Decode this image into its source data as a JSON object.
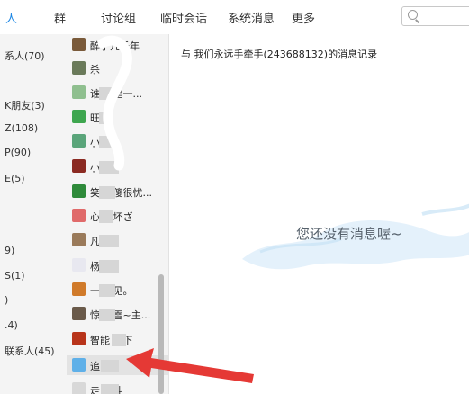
{
  "tabs": [
    "人",
    "群",
    "讨论组",
    "临时会话",
    "系统消息",
    "更多"
  ],
  "search": {
    "placeholder": ""
  },
  "groups": [
    "系人(70)",
    "K朋友(3)",
    "Z(108)",
    "P(90)",
    "E(5)",
    "9)",
    "S(1)",
    ")",
    ".4)",
    "联系人(45)"
  ],
  "contacts": [
    {
      "name": "醉了几千年",
      "avatar_color": "#7a5a3a"
    },
    {
      "name": "杀",
      "avatar_color": "#6a7a5a"
    },
    {
      "name": "谁      只是一...",
      "avatar_color": "#8fbf8f"
    },
    {
      "name": "旺      艺",
      "avatar_color": "#3ea64f"
    },
    {
      "name": "小      弱",
      "avatar_color": "#5aa57a"
    },
    {
      "name": "小",
      "avatar_color": "#8b2a22"
    },
    {
      "name": "笑      艮傻很忧...",
      "avatar_color": "#2e8a3a"
    },
    {
      "name": "心      不坏ざ",
      "avatar_color": "#e06a6a"
    },
    {
      "name": "凡",
      "avatar_color": "#9a7a5a"
    },
    {
      "name": "杨",
      "avatar_color": "#e8e8f0"
    },
    {
      "name": "一      初见。",
      "avatar_color": "#d07a2a"
    },
    {
      "name": "惊      珈雪~主...",
      "avatar_color": "#6a5a4a"
    },
    {
      "name": "智能      天下",
      "avatar_color": "#b8341a"
    },
    {
      "name": "追",
      "avatar_color": "#5fb0e8"
    },
    {
      "name": "走      同斗",
      "avatar_color": "#d8d8d8"
    }
  ],
  "main": {
    "record_title": "与 我们永远手牵手(243688132)的消息记录",
    "empty_text": "您还没有消息喔~"
  },
  "colors": {
    "accent": "#1e88e5",
    "arrow": "#e53935"
  }
}
